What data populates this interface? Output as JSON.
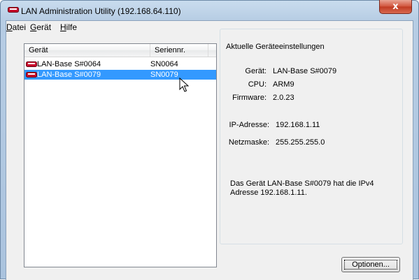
{
  "window": {
    "title": "LAN Administration Utility (192.168.64.110)",
    "close_glyph": "x"
  },
  "menu": {
    "items": [
      {
        "label": "Datei",
        "underline_char": "D"
      },
      {
        "label": "Gerät",
        "underline_char": "G"
      },
      {
        "label": "Hilfe",
        "underline_char": "H"
      }
    ]
  },
  "device_list": {
    "columns": [
      "Gerät",
      "Seriennr."
    ],
    "rows": [
      {
        "device": "LAN-Base S#0064",
        "serial": "SN0064",
        "selected": false
      },
      {
        "device": "LAN-Base S#0079",
        "serial": "SN0079",
        "selected": true
      }
    ]
  },
  "settings": {
    "group_title": "Aktuelle Geräteeinstellungen",
    "fields": {
      "device_label": "Gerät:",
      "device_value": "LAN-Base S#0079",
      "cpu_label": "CPU:",
      "cpu_value": "ARM9",
      "firmware_label": "Firmware:",
      "firmware_value": "2.0.23",
      "ip_label": "IP-Adresse:",
      "ip_value": "192.168.1.11",
      "mask_label": "Netzmaske:",
      "mask_value": "255.255.255.0"
    },
    "info_text": "Das Gerät LAN-Base S#0079 hat die IPv4 Adresse 192.168.1.11."
  },
  "buttons": {
    "options_label": "Optionen..."
  },
  "colors": {
    "selection": "#3399ff",
    "device_icon": "#c8102e"
  },
  "icons": {
    "app": "lan-device-icon",
    "row": "lan-device-icon",
    "cursor": "mouse-pointer-icon"
  }
}
